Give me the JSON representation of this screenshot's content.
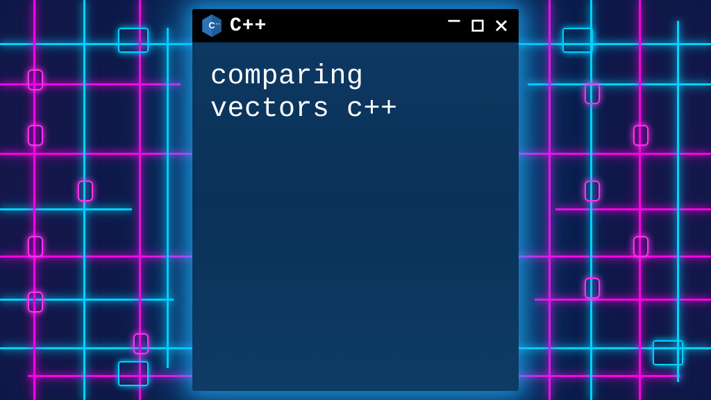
{
  "window": {
    "title": "C++",
    "icon": "cpp-hexagon-icon"
  },
  "content": {
    "text": "comparing\nvectors c++"
  },
  "colors": {
    "window_bg": "#0b355c",
    "titlebar_bg": "#000000",
    "text": "#ffffff",
    "glow": "#1eb4ff",
    "accent_magenta": "#ff00e6",
    "accent_cyan": "#00d4ff",
    "icon_blue": "#1f6fb0"
  }
}
